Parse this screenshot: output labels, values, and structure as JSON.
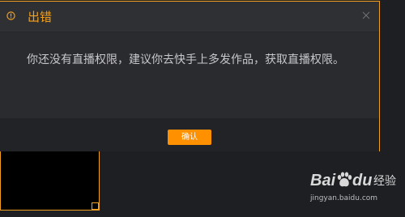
{
  "dialog": {
    "title": "出错",
    "message": "你还没有直播权限，建议你去快手上多发作品，获取直播权限。",
    "confirm_label": "确认",
    "icons": {
      "warning": "warning-circle-icon",
      "close": "close-icon"
    }
  },
  "watermark": {
    "brand_bai": "Bai",
    "brand_du": "du",
    "brand_product": "经验",
    "url": "jingyan.baidu.com",
    "icon": "paw-icon"
  },
  "colors": {
    "accent": "#f0a020",
    "button": "#ff9000",
    "background": "#1d1f23",
    "dialog_body": "#2a2b2f",
    "dialog_header": "#2f3034",
    "dialog_footer": "#222327",
    "message_text": "#c7c7c9"
  }
}
